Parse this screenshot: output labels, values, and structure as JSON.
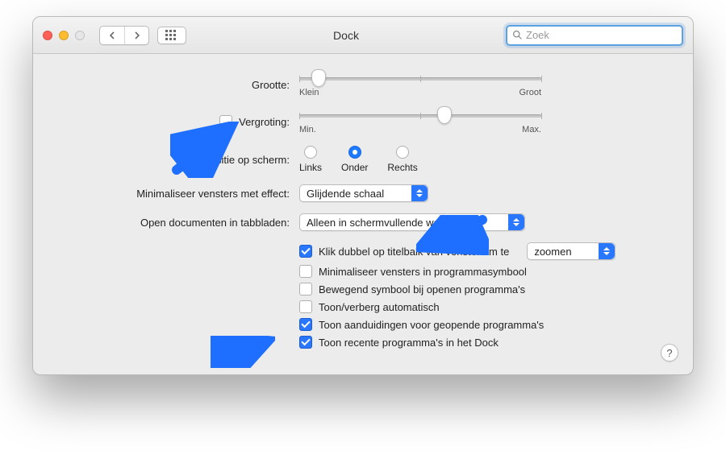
{
  "window": {
    "title": "Dock"
  },
  "toolbar": {
    "search_placeholder": "Zoek"
  },
  "rows": {
    "size": {
      "label": "Grootte:",
      "min": "Klein",
      "max": "Groot",
      "thumb_pct": 8
    },
    "mag": {
      "label": "Vergroting:",
      "min": "Min.",
      "max": "Max.",
      "checked": false,
      "thumb_pct": 60
    },
    "position": {
      "label": "Positie op scherm:",
      "options": [
        "Links",
        "Onder",
        "Rechts"
      ],
      "selected_index": 1
    },
    "minimize_effect": {
      "label": "Minimaliseer vensters met effect:",
      "value": "Glijdende schaal"
    },
    "open_docs": {
      "label": "Open documenten in tabbladen:",
      "value": "Alleen in schermvullende weergave"
    },
    "dblclick": {
      "checked": true,
      "label": "Klik dubbel op titelbalk van venster om te",
      "select_value": "zoomen"
    },
    "min_into_app": {
      "checked": false,
      "label": "Minimaliseer vensters in programmasymbool"
    },
    "animate": {
      "checked": false,
      "label": "Bewegend symbool bij openen programma's"
    },
    "autohide": {
      "checked": false,
      "label": "Toon/verberg automatisch"
    },
    "indicators": {
      "checked": true,
      "label": "Toon aanduidingen voor geopende programma's"
    },
    "recent": {
      "checked": true,
      "label": "Toon recente programma's in het Dock"
    }
  },
  "help": "?"
}
